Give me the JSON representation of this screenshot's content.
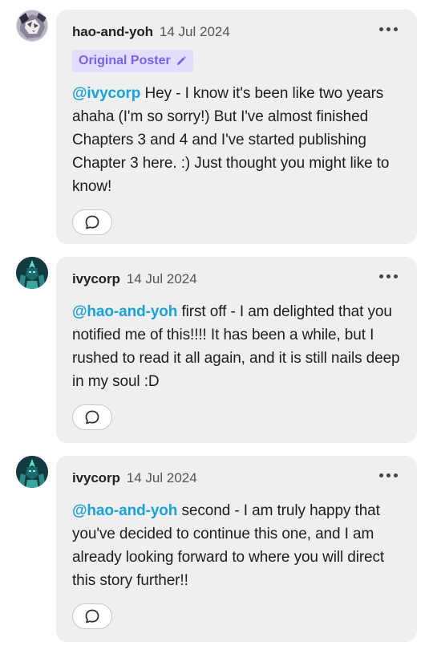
{
  "comments": [
    {
      "username": "hao-and-yoh",
      "date": "14 Jul 2024",
      "badge": "Original Poster",
      "mention": "@ivycorp",
      "text": " Hey - I know it's been like two years ahaha (I'm so sorry!) But I've almost finished Chapters 3 and 4 and I've started publishing Chapter 3 here.  :) Just thought you might like to know!",
      "avatar_icon": "anime-character-avatar",
      "reply_icon": "comment-bubble-icon"
    },
    {
      "username": "ivycorp",
      "date": "14 Jul 2024",
      "mention": "@hao-and-yoh",
      "text": " first off - I am delighted that you notified me of this!!!! It has been a while, but I rushed to read it all again, and it is still nails deep in my soul :D",
      "avatar_icon": "cyber-character-avatar",
      "reply_icon": "comment-bubble-icon"
    },
    {
      "username": "ivycorp",
      "date": "14 Jul 2024",
      "mention": "@hao-and-yoh",
      "text": " second - I am truly happy that you've decided to continue this one, and I am already looking forward to where you will direct this story further!!",
      "avatar_icon": "cyber-character-avatar",
      "reply_icon": "comment-bubble-icon"
    }
  ],
  "colors": {
    "bubble_bg": "#efefef",
    "mention": "#1aa2d6",
    "badge_bg": "#e1ddfb",
    "badge_text": "#7b61e8"
  }
}
